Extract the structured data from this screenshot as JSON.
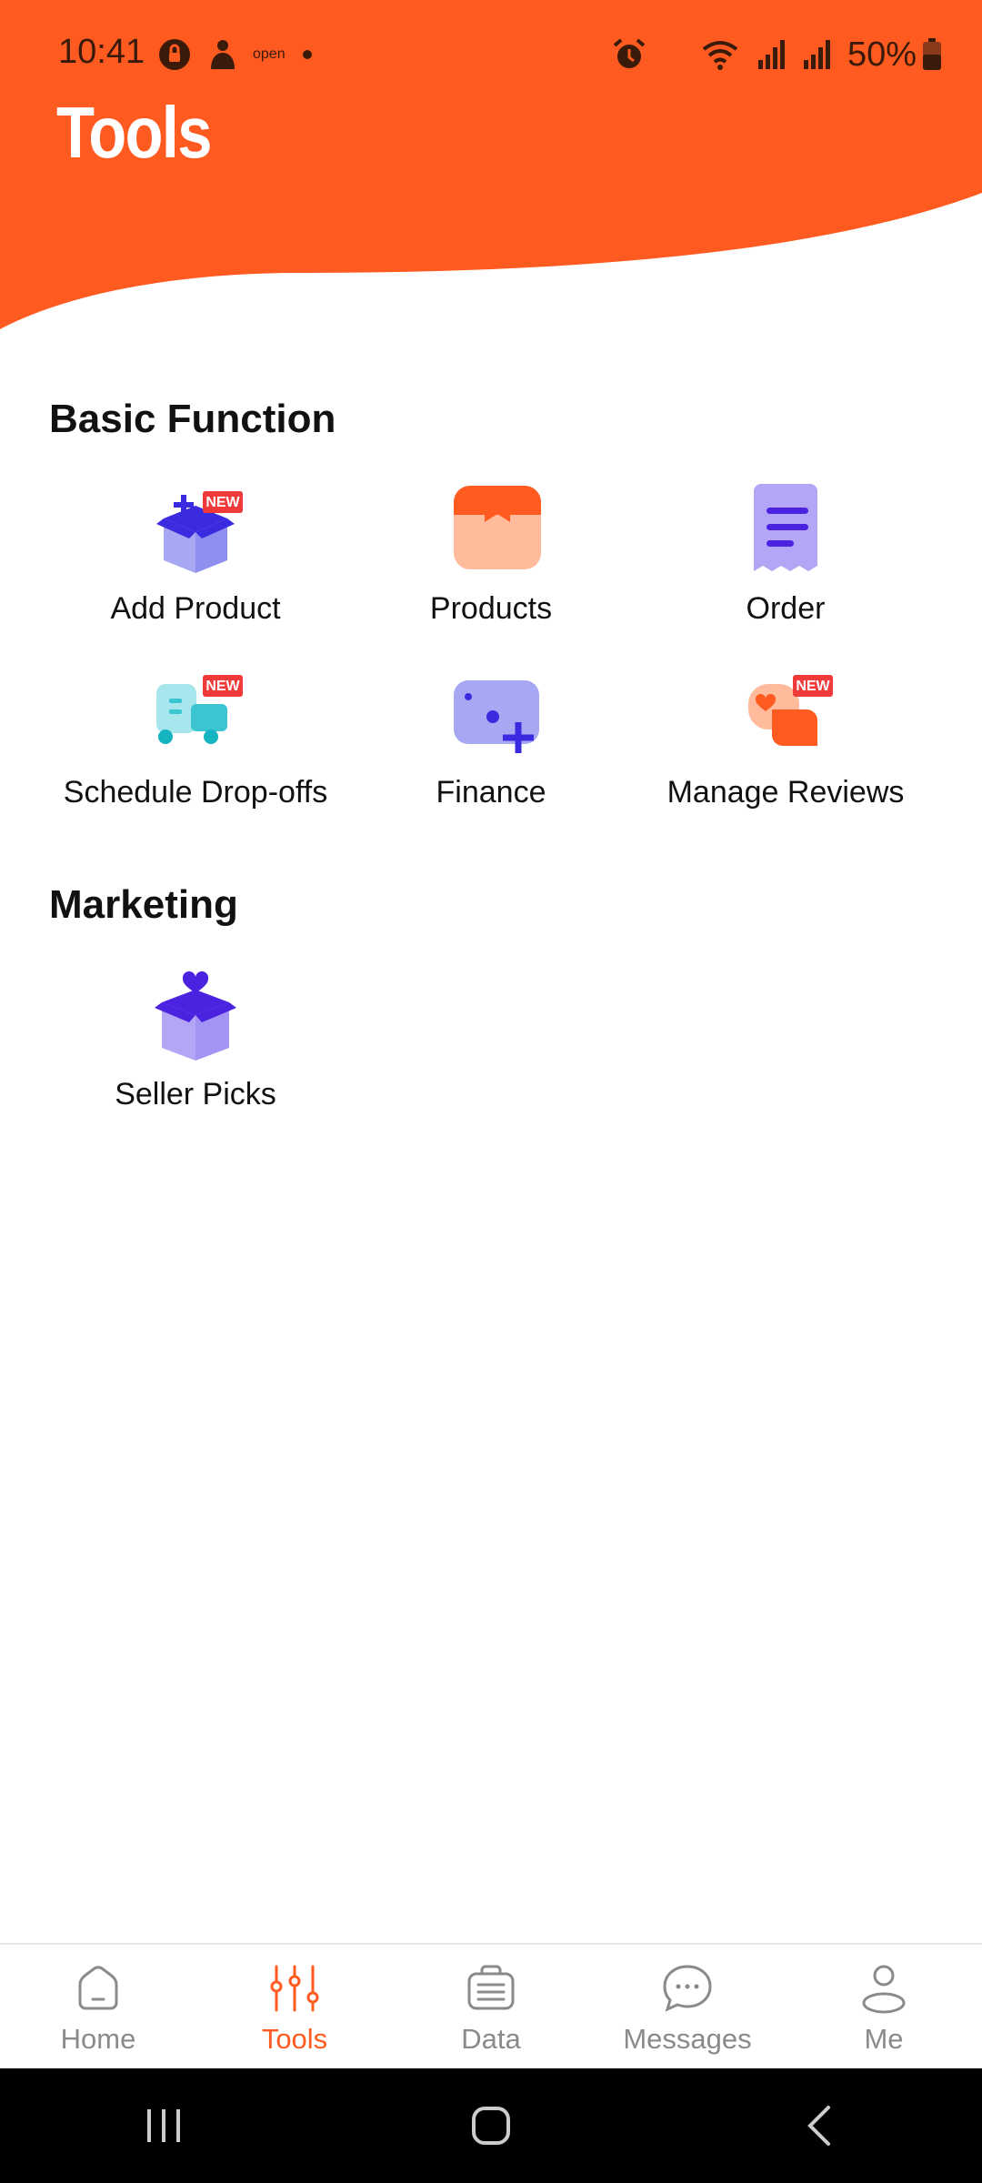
{
  "status_bar": {
    "time": "10:41",
    "open_text": "open",
    "battery": "50%"
  },
  "header": {
    "title": "Tools"
  },
  "sections": [
    {
      "title": "Basic Function",
      "items": [
        {
          "label": "Add Product",
          "icon": "add-product-box-icon",
          "badge": "NEW"
        },
        {
          "label": "Products",
          "icon": "products-box-icon"
        },
        {
          "label": "Order",
          "icon": "order-receipt-icon"
        },
        {
          "label": "Schedule Drop-offs",
          "icon": "delivery-truck-icon",
          "badge": "NEW"
        },
        {
          "label": "Finance",
          "icon": "finance-card-icon"
        },
        {
          "label": "Manage Reviews",
          "icon": "reviews-chat-icon",
          "badge": "NEW"
        }
      ]
    },
    {
      "title": "Marketing",
      "items": [
        {
          "label": "Seller Picks",
          "icon": "seller-picks-heart-box-icon"
        }
      ]
    }
  ],
  "bottom_nav": [
    {
      "label": "Home",
      "icon": "home-icon",
      "active": false
    },
    {
      "label": "Tools",
      "icon": "tools-sliders-icon",
      "active": true
    },
    {
      "label": "Data",
      "icon": "data-clipboard-icon",
      "active": false
    },
    {
      "label": "Messages",
      "icon": "messages-chat-icon",
      "active": false
    },
    {
      "label": "Me",
      "icon": "profile-icon",
      "active": false
    }
  ],
  "colors": {
    "brand": "#ff5a1f",
    "badge": "#f03a3a",
    "inactive": "#8a8a8a"
  }
}
